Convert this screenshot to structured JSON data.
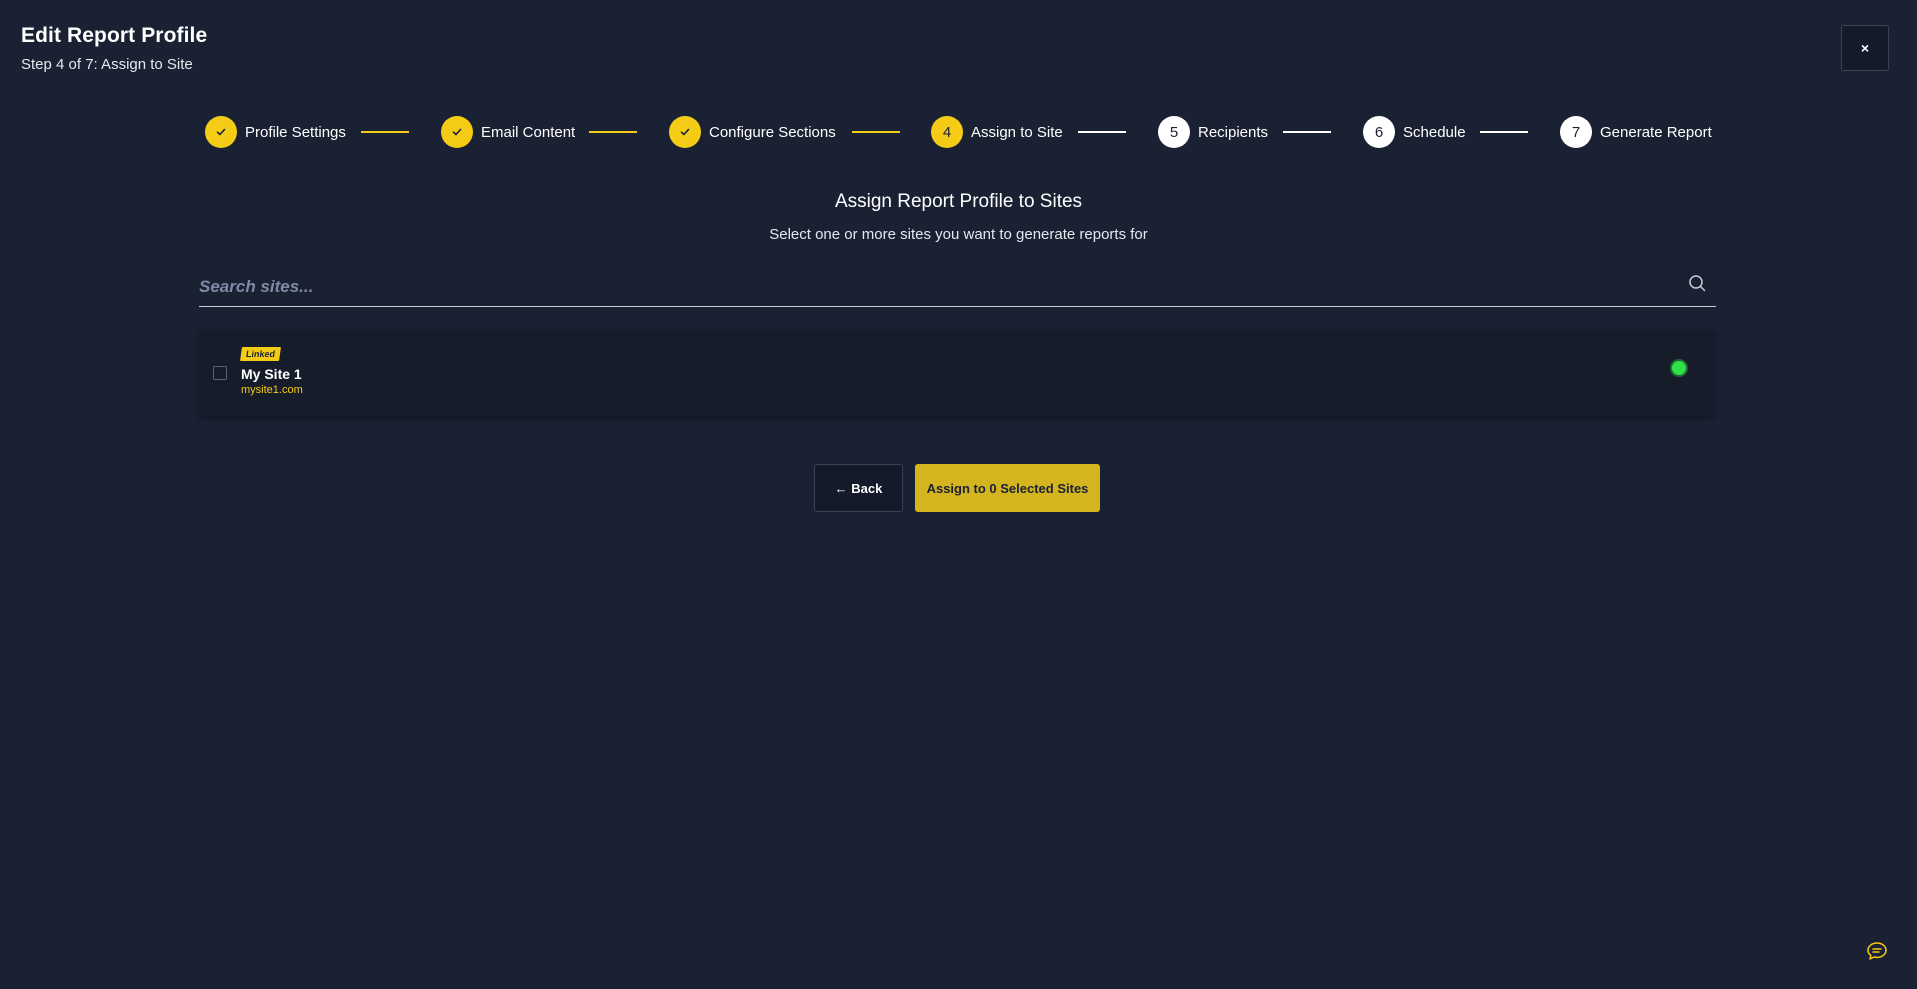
{
  "header": {
    "title": "Edit Report Profile",
    "subtitle": "Step 4 of 7: Assign to Site",
    "close_label": "×"
  },
  "stepper": {
    "steps": [
      {
        "number": "1",
        "label": "Profile Settings",
        "state": "done"
      },
      {
        "number": "2",
        "label": "Email Content",
        "state": "done"
      },
      {
        "number": "3",
        "label": "Configure Sections",
        "state": "done"
      },
      {
        "number": "4",
        "label": "Assign to Site",
        "state": "active"
      },
      {
        "number": "5",
        "label": "Recipients",
        "state": "todo"
      },
      {
        "number": "6",
        "label": "Schedule",
        "state": "todo"
      },
      {
        "number": "7",
        "label": "Generate Report",
        "state": "todo"
      }
    ]
  },
  "main": {
    "title": "Assign Report Profile to Sites",
    "subtitle": "Select one or more sites you want to generate reports for",
    "search": {
      "placeholder": "Search sites...",
      "value": ""
    },
    "sites": [
      {
        "badge": "Linked",
        "name": "My Site 1",
        "url": "mysite1.com",
        "checked": false,
        "status": "online"
      }
    ],
    "back_label": "← Back",
    "assign_label": "Assign to 0 Selected Sites"
  },
  "colors": {
    "background": "#1a2133",
    "accent": "#f5cc15",
    "status_online": "#2ee04a"
  },
  "icons": {
    "check": "check-icon",
    "search": "search-icon",
    "close": "close-icon",
    "chat": "chat-icon",
    "back_arrow": "arrow-left-icon"
  }
}
